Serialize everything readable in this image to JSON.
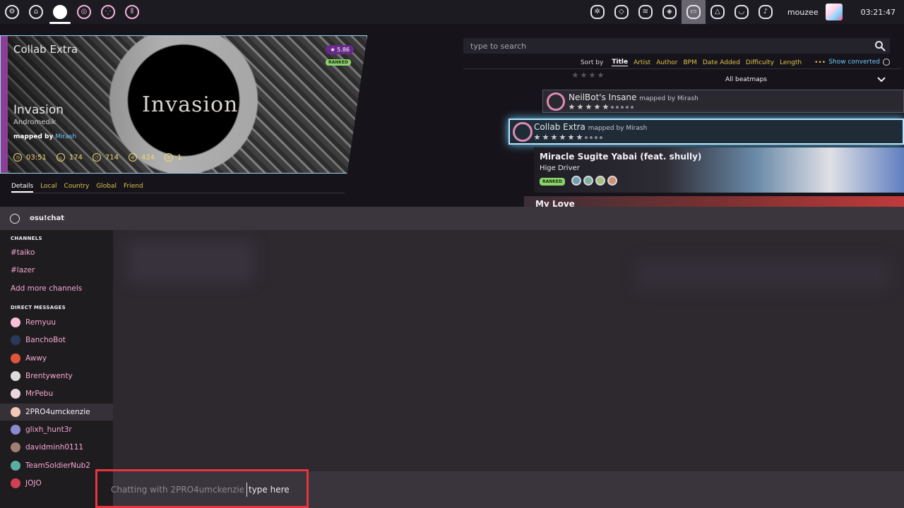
{
  "toolbar": {
    "left_buttons": [
      {
        "icon": "gear-icon",
        "glyph": "⚙"
      },
      {
        "icon": "home-icon",
        "glyph": "⌂"
      },
      {
        "icon": "osu-ruleset-icon",
        "glyph": "●"
      },
      {
        "icon": "taiko-ruleset-icon",
        "glyph": "◎"
      },
      {
        "icon": "catch-ruleset-icon",
        "glyph": "⁛"
      },
      {
        "icon": "mania-ruleset-icon",
        "glyph": "⦀"
      }
    ],
    "right_buttons": [
      {
        "icon": "daily-icon",
        "glyph": "✲"
      },
      {
        "icon": "dashboard-icon",
        "glyph": "◇"
      },
      {
        "icon": "news-icon",
        "glyph": "≋"
      },
      {
        "icon": "rankings-icon",
        "glyph": "◈"
      },
      {
        "icon": "chat-icon",
        "glyph": "▭"
      },
      {
        "icon": "beatmap-listing-icon",
        "glyph": "△"
      },
      {
        "icon": "notifications-icon",
        "glyph": "◡"
      },
      {
        "icon": "music-icon",
        "glyph": "♪"
      }
    ],
    "username": "mouzee",
    "clock": "03:21:47"
  },
  "beatmap_wedge": {
    "difficulty_name": "Collab Extra",
    "star_rating": "★ 5.86",
    "status": "RANKED",
    "logo_text": "Invasion",
    "title": "Invasion",
    "artist": "Andromedik",
    "mapped_by_label": "mapped by",
    "mapper": "Mirash",
    "stats": [
      {
        "icon": "length-icon",
        "value": "03:51"
      },
      {
        "icon": "bpm-icon",
        "value": "174"
      },
      {
        "icon": "circles-icon",
        "value": "714"
      },
      {
        "icon": "sliders-icon",
        "value": "424"
      },
      {
        "icon": "spinners-icon",
        "value": "1"
      }
    ]
  },
  "detail_tabs": [
    "Details",
    "Local",
    "Country",
    "Global",
    "Friend"
  ],
  "search": {
    "placeholder": "type to search",
    "sort_by_label": "Sort by",
    "sort_options": [
      "Title",
      "Artist",
      "Author",
      "BPM",
      "Date Added",
      "Difficulty",
      "Length"
    ],
    "sort_active": "Title",
    "more_label": "•••",
    "show_converted_label": "Show converted",
    "filter_value": "All beatmaps"
  },
  "carousel": {
    "panel_1": {
      "difficulty": "NeilBot's Insane",
      "mapped_by": "mapped by Mirash",
      "stars": 5
    },
    "panel_2": {
      "difficulty": "Collab Extra",
      "mapped_by": "mapped by Mirash",
      "stars": 6
    },
    "panel_3": {
      "title": "Miracle Sugite Yabai (feat. shully)",
      "artist": "Hige Driver",
      "status": "RANKED"
    },
    "panel_4": {
      "title": "My Love"
    }
  },
  "chat": {
    "title": "osu!chat",
    "channels_heading": "CHANNELS",
    "channels": [
      "#taiko",
      "#lazer",
      "Add more channels"
    ],
    "dm_heading": "DIRECT MESSAGES",
    "direct_messages": [
      {
        "name": "Remyuu",
        "color": "#f7c0d8"
      },
      {
        "name": "BanchoBot",
        "color": "#2a3a5a"
      },
      {
        "name": "Awwy",
        "color": "#e0543a"
      },
      {
        "name": "Brentywenty",
        "color": "#dcdcdc"
      },
      {
        "name": "MrPebu",
        "color": "#e8d6e0"
      },
      {
        "name": "2PRO4umckenzie",
        "color": "#f2c8b8"
      },
      {
        "name": "glixh_hunt3r",
        "color": "#8a8ad0"
      },
      {
        "name": "davidminh0111",
        "color": "#a08070"
      },
      {
        "name": "TeamSoldierNub2",
        "color": "#5ab0a0"
      },
      {
        "name": "JOJO",
        "color": "#d04050"
      }
    ],
    "active_dm": "2PRO4umckenzie",
    "input_hint": "Chatting with 2PRO4umckenzie",
    "input_placeholder": "type here"
  },
  "colors": {
    "accent_pink": "#f4a9cf",
    "highlight": "#e8343f",
    "selected_glow": "#66c8f5"
  }
}
